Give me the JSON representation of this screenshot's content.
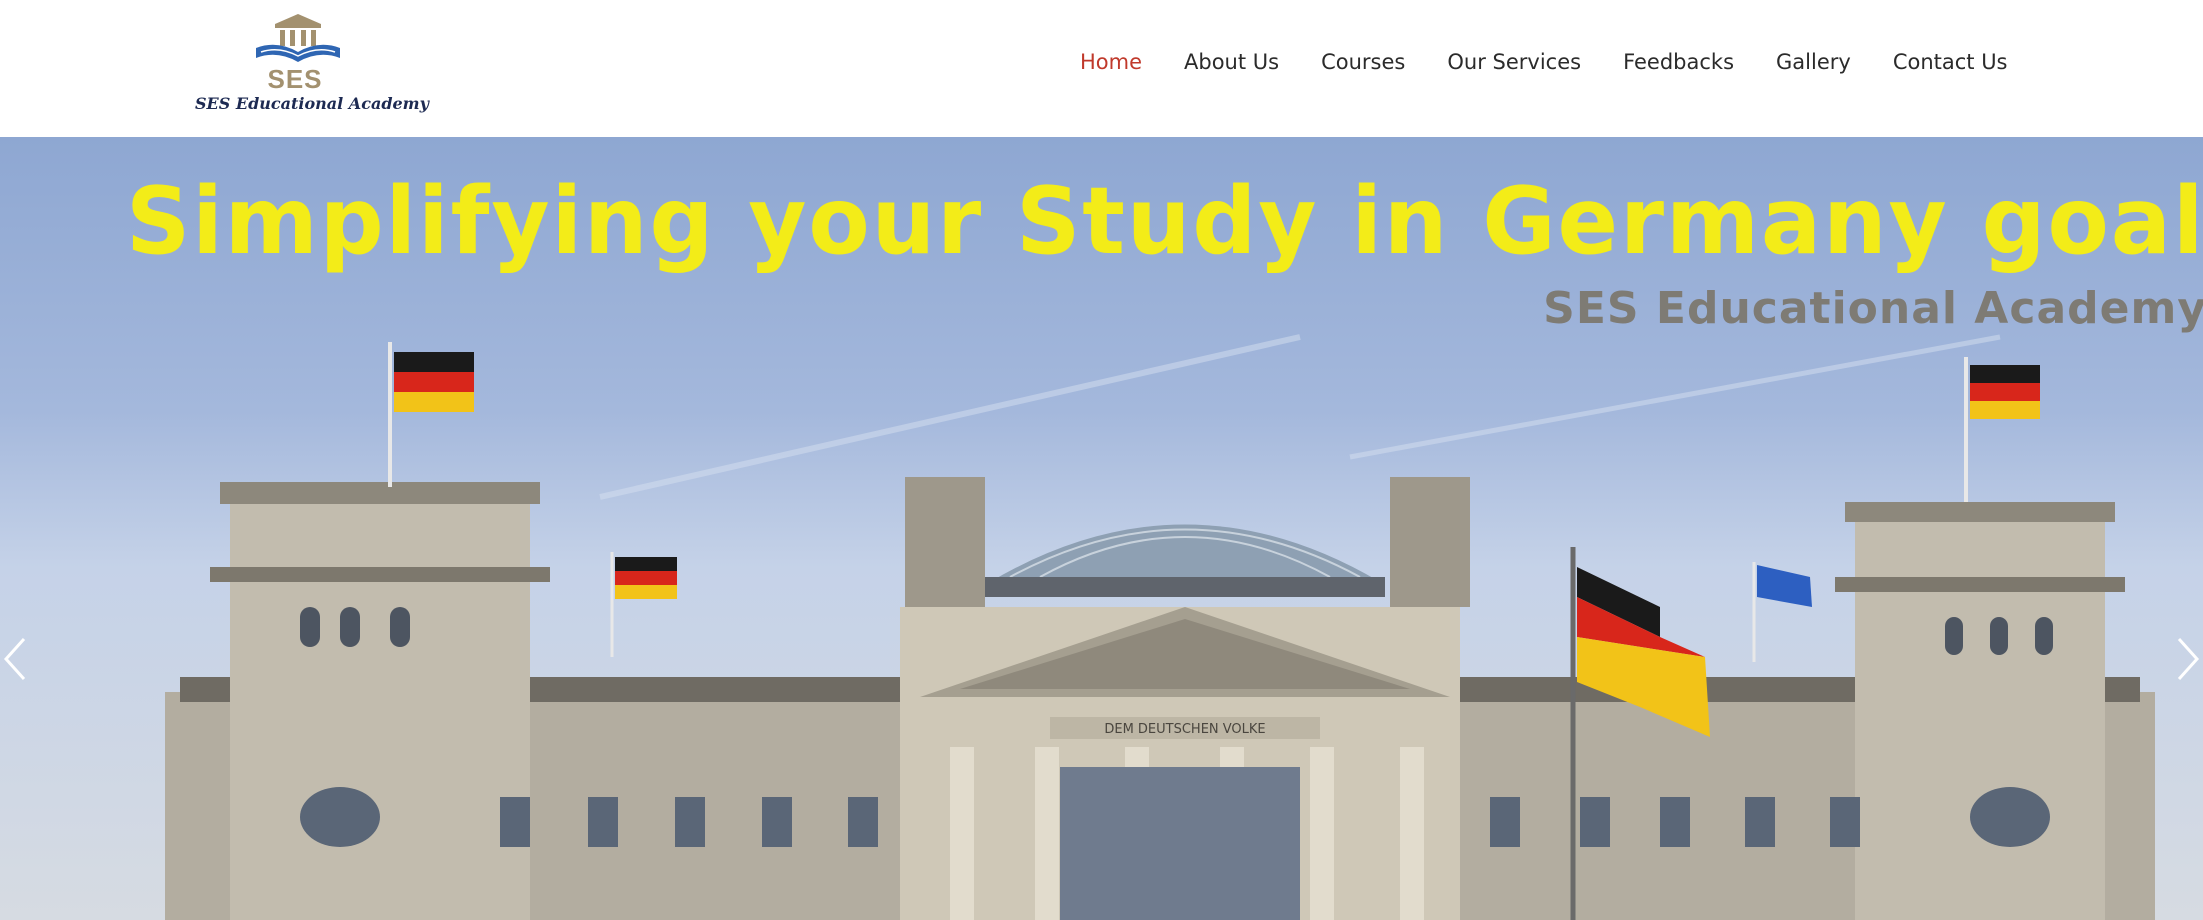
{
  "brand": {
    "abbr": "SES",
    "name": "SES Educational Academy"
  },
  "nav": {
    "items": [
      {
        "label": "Home",
        "active": true
      },
      {
        "label": "About Us"
      },
      {
        "label": "Courses"
      },
      {
        "label": "Our Services"
      },
      {
        "label": "Feedbacks"
      },
      {
        "label": "Gallery"
      },
      {
        "label": "Contact Us"
      }
    ]
  },
  "hero": {
    "headline": "Simplifying your Study in Germany goals",
    "watermark": "SES Educational Academy",
    "building_inscription": "DEM DEUTSCHEN VOLKE",
    "prev_icon": "chevron-left-icon",
    "next_icon": "chevron-right-icon"
  },
  "colors": {
    "nav_active": "#c0392b",
    "headline": "#f3ec18",
    "logo_gold": "#a3916f",
    "logo_navy": "#1d2a52"
  }
}
